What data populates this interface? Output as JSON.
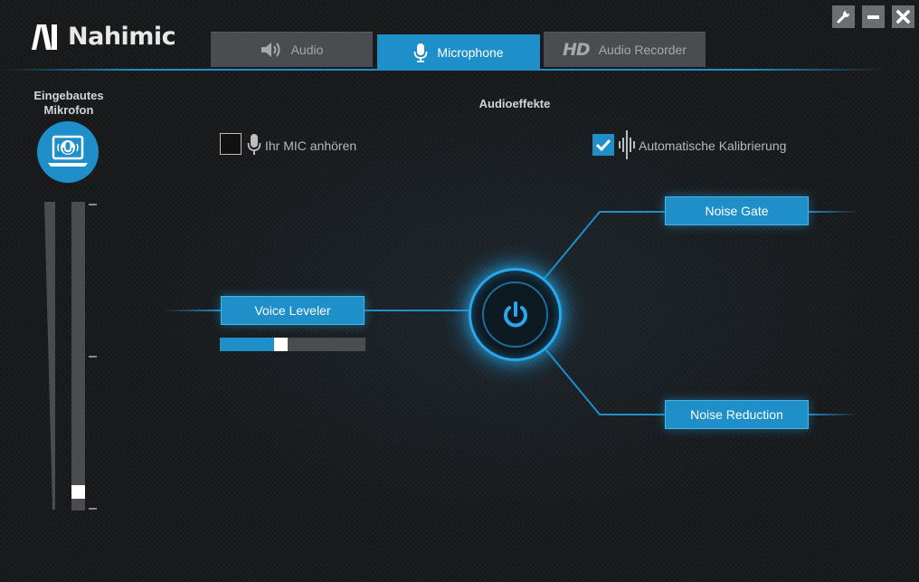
{
  "app": {
    "name": "Nahimic"
  },
  "window_controls": [
    {
      "name": "settings",
      "icon": "wrench-icon"
    },
    {
      "name": "minimize",
      "icon": "minus-icon"
    },
    {
      "name": "close",
      "icon": "close-icon"
    }
  ],
  "tabs": [
    {
      "label": "Audio",
      "icon": "speaker-icon",
      "active": false
    },
    {
      "label": "Microphone",
      "icon": "microphone-icon",
      "active": true
    },
    {
      "prefix": "HD",
      "label": "Audio Recorder",
      "icon": "hd-icon",
      "active": false
    }
  ],
  "device": {
    "label": "Eingebautes Mikrofon",
    "icon": "laptop-microphone-icon",
    "meter_level": 0.04
  },
  "effects": {
    "title": "Audioeffekte",
    "listen_mic": {
      "label": "Ihr MIC anhören",
      "checked": false,
      "icon": "microphone-icon"
    },
    "auto_calibration": {
      "label": "Automatische Kalibrierung",
      "checked": true,
      "icon": "waveform-icon"
    },
    "voice_leveler": {
      "label": "Voice Leveler",
      "slider_level": 0.41
    },
    "noise_gate": {
      "label": "Noise Gate"
    },
    "noise_reduction": {
      "label": "Noise Reduction"
    },
    "power": {
      "icon": "power-icon",
      "on": true
    }
  },
  "colors": {
    "accent": "#1e8fc8",
    "inactive_tab": "#4a4c50",
    "background": "#141618",
    "knob": "#ffffff"
  }
}
